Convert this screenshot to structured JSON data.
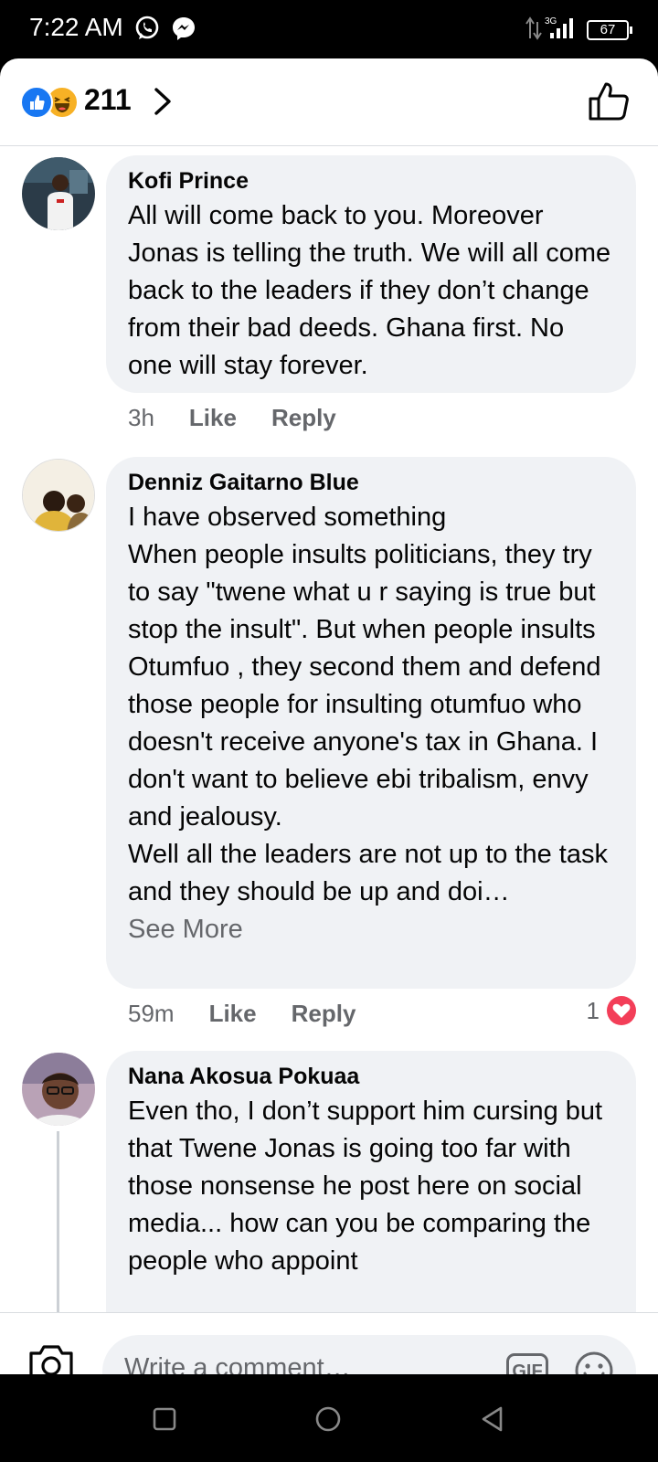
{
  "status_bar": {
    "time": "7:22 AM",
    "network": "3G",
    "battery": "67",
    "icons": [
      "whatsapp-icon",
      "messenger-icon",
      "data-arrows-icon",
      "signal-icon"
    ]
  },
  "reactions": {
    "count": "211",
    "icons": [
      "like-reaction-icon",
      "haha-reaction-icon"
    ]
  },
  "comments": [
    {
      "author": "Kofi Prince",
      "text": "All will come back to you. Moreover Jonas is telling the truth. We will all come back to the leaders if they don’t change from their bad deeds. Ghana first. No one will stay forever.",
      "time": "3h",
      "like_label": "Like",
      "reply_label": "Reply"
    },
    {
      "author": "Denniz Gaitarno Blue",
      "text": "I have observed something\nWhen people insults politicians, they try to say \"twene what u r saying is true but stop the insult\". But when people insults Otumfuo , they second them and defend those people for insulting otumfuo who doesn't receive anyone's tax in Ghana. I don't want to believe ebi tribalism, envy and jealousy.\nWell all the leaders are not up to the task and they should be up and doi…",
      "see_more": "See More",
      "time": "59m",
      "like_label": "Like",
      "reply_label": "Reply",
      "reaction_count": "1"
    },
    {
      "author": "Nana Akosua Pokuaa",
      "text": "Even tho, I don’t support him cursing but that Twene Jonas is going too far with those nonsense he post here on social media... how can you be ",
      "text_cut": "comparing the people who appoint"
    }
  ],
  "composer": {
    "placeholder": "Write a comment…",
    "gif_label": "GIF"
  },
  "colors": {
    "bubble": "#f0f2f5",
    "secondary_text": "#65676b",
    "like_blue": "#1877f2",
    "heart_red": "#f33e58"
  }
}
